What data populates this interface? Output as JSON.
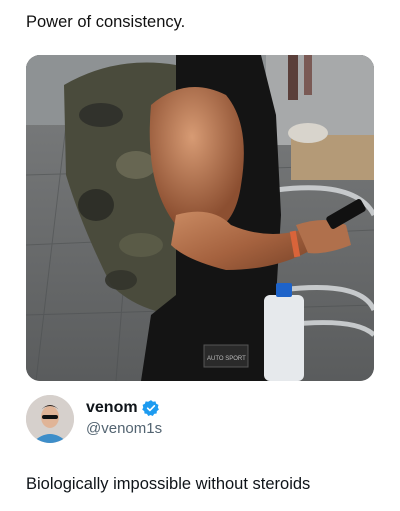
{
  "post": {
    "caption": "Power of consistency.",
    "photo": {
      "icon": "photo-of-muscular-arm",
      "shirt_label": "AUTO SPORT"
    }
  },
  "quoted_tweet": {
    "display_name": "venom",
    "handle": "@venom1s",
    "verified": true,
    "verified_color": "#1d9bf0",
    "text": "Biologically impossible without steroids"
  }
}
